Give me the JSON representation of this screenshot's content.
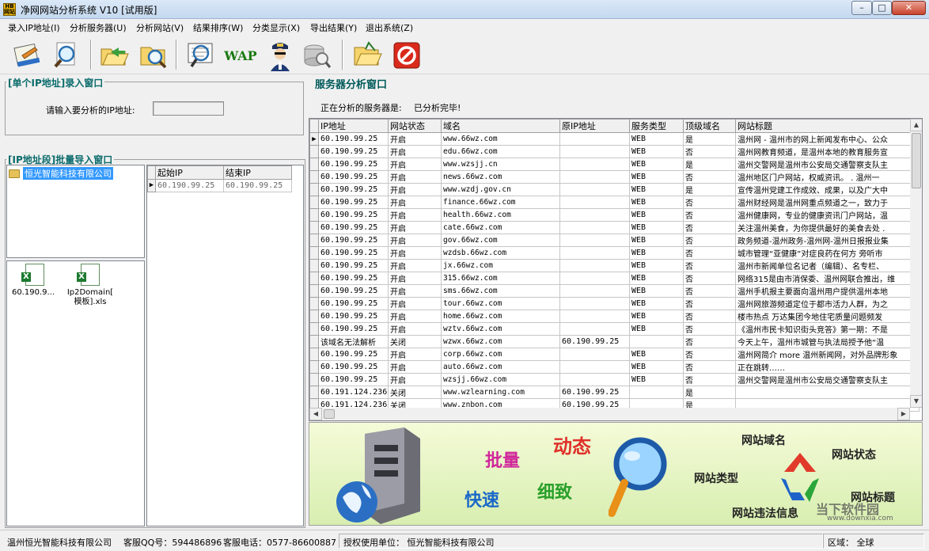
{
  "app": {
    "icon_text": "HB网站",
    "title": "净网网站分析系统 V10 [试用版]"
  },
  "window_controls": {
    "minimize": "–",
    "maximize": "□",
    "close": "✕"
  },
  "menu": [
    "录入IP地址(I)",
    "分析服务器(U)",
    "分析网站(V)",
    "结果排序(W)",
    "分类显示(X)",
    "导出结果(Y)",
    "退出系统(Z)"
  ],
  "toolbar": {
    "wap_label": "WAP",
    "icons": [
      "notebook-icon",
      "magnifier-icon",
      "folder-arrow-icon",
      "folder-search-icon",
      "scan-page-icon",
      "wap-icon",
      "police-icon",
      "server-icon",
      "open-folder-icon",
      "stop-icon"
    ]
  },
  "single_ip": {
    "title": "[单个IP地址]录入窗口",
    "label": "请输入要分析的IP地址:",
    "value": ""
  },
  "batch": {
    "title": "[IP地址段]批量导入窗口",
    "tree_item": "恒光智能科技有限公司",
    "range_headers": [
      "起始IP",
      "结束IP"
    ],
    "range_rows": [
      [
        "60.190.99.25",
        "60.190.99.25"
      ]
    ],
    "files": [
      {
        "label": "60.190.9..."
      },
      {
        "label": "Ip2Domain[\n模板].xls"
      }
    ]
  },
  "server": {
    "title": "服务器分析窗口",
    "status_label": "正在分析的服务器是:",
    "status_value": "已分析完毕!",
    "headers": [
      "IP地址",
      "网站状态",
      "域名",
      "原IP地址",
      "服务类型",
      "顶级域名",
      "网站标题"
    ],
    "rows": [
      [
        "60.190.99.25",
        "开启",
        "www.66wz.com",
        "",
        "WEB",
        "是",
        "温州网 - 温州市的网上新闻发布中心、公众"
      ],
      [
        "60.190.99.25",
        "开启",
        "edu.66wz.com",
        "",
        "WEB",
        "否",
        "温州网教育频道，是温州本地的教育服务宣"
      ],
      [
        "60.190.99.25",
        "开启",
        "www.wzsjj.cn",
        "",
        "WEB",
        "是",
        "温州交警网是温州市公安局交通警察支队主"
      ],
      [
        "60.190.99.25",
        "开启",
        "news.66wz.com",
        "",
        "WEB",
        "否",
        "温州地区门户网站，权威资讯。 . 温州一"
      ],
      [
        "60.190.99.25",
        "开启",
        "www.wzdj.gov.cn",
        "",
        "WEB",
        "是",
        "宣传温州党建工作成效、成果，以及广大中"
      ],
      [
        "60.190.99.25",
        "开启",
        "finance.66wz.com",
        "",
        "WEB",
        "否",
        "温州财经网是温州网重点频道之一，致力于"
      ],
      [
        "60.190.99.25",
        "开启",
        "health.66wz.com",
        "",
        "WEB",
        "否",
        "温州健康网，专业的健康资讯门户网站，温"
      ],
      [
        "60.190.99.25",
        "开启",
        "cate.66wz.com",
        "",
        "WEB",
        "否",
        "关注温州美食，为你提供最好的美食去处 ."
      ],
      [
        "60.190.99.25",
        "开启",
        "gov.66wz.com",
        "",
        "WEB",
        "否",
        "政务频道-温州政务-温州网-温州日报报业集"
      ],
      [
        "60.190.99.25",
        "开启",
        "wzdsb.66wz.com",
        "",
        "WEB",
        "否",
        "城市管理“亚健康”对症良药在何方 旁听市"
      ],
      [
        "60.190.99.25",
        "开启",
        "jx.66wz.com",
        "",
        "WEB",
        "否",
        "温州市新闻单位名记者（编辑）、名专栏、"
      ],
      [
        "60.190.99.25",
        "开启",
        "315.66wz.com",
        "",
        "WEB",
        "否",
        "网络315是由市消保委、温州网联合推出，维"
      ],
      [
        "60.190.99.25",
        "开启",
        "sms.66wz.com",
        "",
        "WEB",
        "否",
        "温州手机报主要面向温州用户提供温州本地"
      ],
      [
        "60.190.99.25",
        "开启",
        "tour.66wz.com",
        "",
        "WEB",
        "否",
        "温州网旅游频道定位于都市活力人群，为之"
      ],
      [
        "60.190.99.25",
        "开启",
        "home.66wz.com",
        "",
        "WEB",
        "否",
        "楼市热点 万达集团今地住宅质量问题频发"
      ],
      [
        "60.190.99.25",
        "开启",
        "wztv.66wz.com",
        "",
        "WEB",
        "否",
        "《温州市民卡知识街头竞答》第一期：不是"
      ],
      [
        "该域名无法解析",
        "关闭",
        "wzwx.66wz.com",
        "60.190.99.25",
        "",
        "否",
        "今天上午，温州市城管与执法局授予他“温"
      ],
      [
        "60.190.99.25",
        "开启",
        "corp.66wz.com",
        "",
        "WEB",
        "否",
        "温州网简介 more 温州新闻网，对外品牌形象"
      ],
      [
        "60.190.99.25",
        "开启",
        "auto.66wz.com",
        "",
        "WEB",
        "否",
        "正在跳转……"
      ],
      [
        "60.190.99.25",
        "开启",
        "wzsjj.66wz.com",
        "",
        "WEB",
        "否",
        "温州交警网是温州市公安局交通警察支队主"
      ],
      [
        "60.191.124.236",
        "关闭",
        "www.wzlearning.com",
        "60.190.99.25",
        "",
        "是",
        ""
      ],
      [
        "60.191.124.236",
        "关闭",
        "www.znbon.com",
        "60.190.99.25",
        "",
        "是",
        ""
      ]
    ]
  },
  "banner": {
    "w1": "批量",
    "w2": "动态",
    "w3": "快速",
    "w4": "细致",
    "w5": "网站域名",
    "w6": "网站状态",
    "w7": "网站类型",
    "w8": "网站标题",
    "w9": "网站违法信息",
    "watermark": "当下软件园",
    "watermark_url": "www.downxia.com"
  },
  "status": {
    "company": "温州恒光智能科技有限公司",
    "qq": "客服QQ号：594486896",
    "phone": "客服电话：0577-86600887",
    "license": "授权使用单位：  恒光智能科技有限公司",
    "region": "区域：  全球"
  }
}
